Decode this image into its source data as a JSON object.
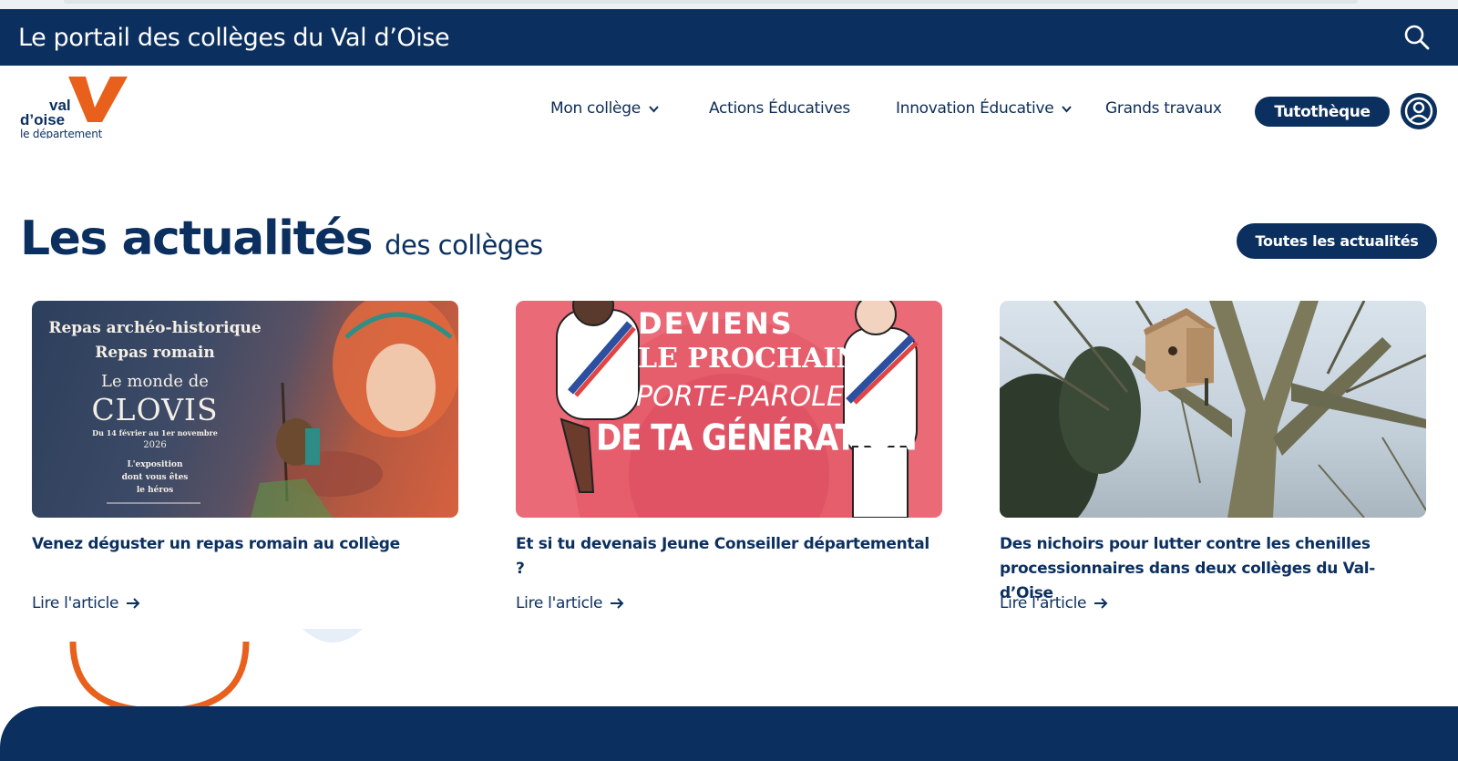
{
  "topbar": {
    "title": "Le portail des collèges du Val d’Oise",
    "search_icon": "search-icon"
  },
  "logo": {
    "line1": "val",
    "line2": "d’oise",
    "line3": "le département",
    "mark": "V"
  },
  "nav": {
    "items": [
      {
        "label": "Mon collège",
        "has_dropdown": true
      },
      {
        "label": "Actions Éducatives",
        "has_dropdown": false
      },
      {
        "label": "Innovation Éducative",
        "has_dropdown": true
      },
      {
        "label": "Grands travaux",
        "has_dropdown": false
      }
    ],
    "tuto_label": "Tutothèque",
    "account_icon": "user-circle-icon"
  },
  "news": {
    "title_big": "Les actualités",
    "title_small": "des collèges",
    "all_button": "Toutes les actualités",
    "read_label": "Lire l'article",
    "cards": [
      {
        "title": "Venez déguster un repas romain au collège",
        "image_text": {
          "l1": "Repas archéo-historique",
          "l2": "Repas romain",
          "l3": "Le monde de",
          "l4": "CLOVIS",
          "l5": "Du 14 février au 1er novembre",
          "l6": "2026",
          "l7": "L'exposition",
          "l8": "dont vous êtes",
          "l9": "le héros"
        }
      },
      {
        "title": "Et si tu devenais Jeune Conseiller départemental ?",
        "image_text": {
          "l1": "DEVIENS",
          "l2": "LE PROCHAIN",
          "l3": "PORTE-PAROLE",
          "l4": "DE TA GÉNÉRATION"
        }
      },
      {
        "title": "Des nichoirs pour lutter contre les chenilles processionnaires dans deux collèges du Val-d’Oise"
      }
    ]
  },
  "colors": {
    "navy": "#0b2f5e",
    "orange": "#e8601c",
    "white": "#ffffff"
  }
}
